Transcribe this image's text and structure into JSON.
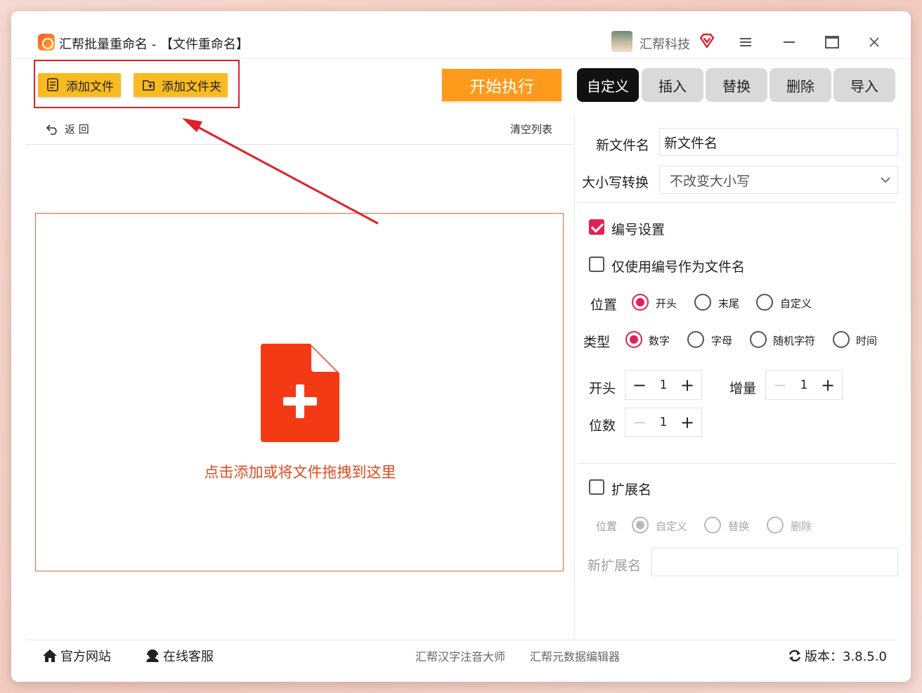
{
  "app": {
    "title": "汇帮批量重命名 - 【文件重命名】",
    "company": "汇帮科技"
  },
  "toolbar": {
    "add_file": "添加文件",
    "add_folder": "添加文件夹",
    "start": "开始执行"
  },
  "mode_tabs": [
    {
      "label": "自定义",
      "active": true
    },
    {
      "label": "插入",
      "active": false
    },
    {
      "label": "替换",
      "active": false
    },
    {
      "label": "删除",
      "active": false
    },
    {
      "label": "导入",
      "active": false
    }
  ],
  "file_list": {
    "back": "返 回",
    "clear": "清空列表",
    "drop_hint": "点击添加或将文件拖拽到这里"
  },
  "settings": {
    "new_name_label": "新文件名",
    "new_name_value": "新文件名",
    "case_label": "大小写转换",
    "case_value": "不改变大小写",
    "numbering": {
      "label": "编号设置",
      "checked": true,
      "only_number_label": "仅使用编号作为文件名",
      "only_number_checked": false,
      "position_label": "位置",
      "position_options": [
        "开头",
        "末尾",
        "自定义"
      ],
      "position_selected": "开头",
      "type_label": "类型",
      "type_options": [
        "数字",
        "字母",
        "随机字符",
        "时间"
      ],
      "type_selected": "数字",
      "start_label": "开头",
      "start_value": "1",
      "increment_label": "增量",
      "increment_value": "1",
      "digits_label": "位数",
      "digits_value": "1"
    },
    "extension": {
      "label": "扩展名",
      "checked": false,
      "position_label": "位置",
      "options": [
        "自定义",
        "替换",
        "删除"
      ],
      "selected": "自定义",
      "new_ext_label": "新扩展名",
      "new_ext_value": ""
    }
  },
  "footer": {
    "website": "官方网站",
    "support": "在线客服",
    "link1": "汇帮汉字注音大师",
    "link2": "汇帮元数据编辑器",
    "version": "版本：3.8.5.0"
  },
  "colors": {
    "accent": "#e51f53",
    "toolbar_button": "#f9bb1f",
    "start_button": "#fd9a1c",
    "drop_border": "#e0683c",
    "drop_icon": "#f43a14",
    "highlight": "#e0202a"
  }
}
